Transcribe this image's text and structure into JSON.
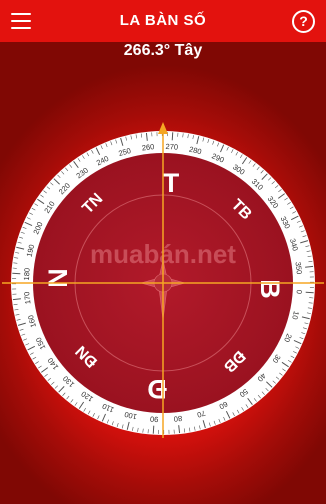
{
  "header": {
    "title": "LA BÀN SỐ",
    "menu_icon": "hamburger-menu-icon",
    "help_label": "?",
    "help_icon": "help-icon"
  },
  "heading": {
    "text": "266.3° Tây",
    "degrees": 266.3,
    "direction": "Tây"
  },
  "compass": {
    "cardinals": {
      "north": "B",
      "east": "Đ",
      "south": "N",
      "west": "T"
    },
    "intercardinals": {
      "nw": "TB",
      "sw": "TN",
      "ne": "ĐB",
      "se": "ĐN"
    },
    "watermark": "muabán.net",
    "colors": {
      "accent": "#f5a623",
      "ring": "#ffffff",
      "dial": "#a81624",
      "bar": "#e3120e"
    }
  }
}
